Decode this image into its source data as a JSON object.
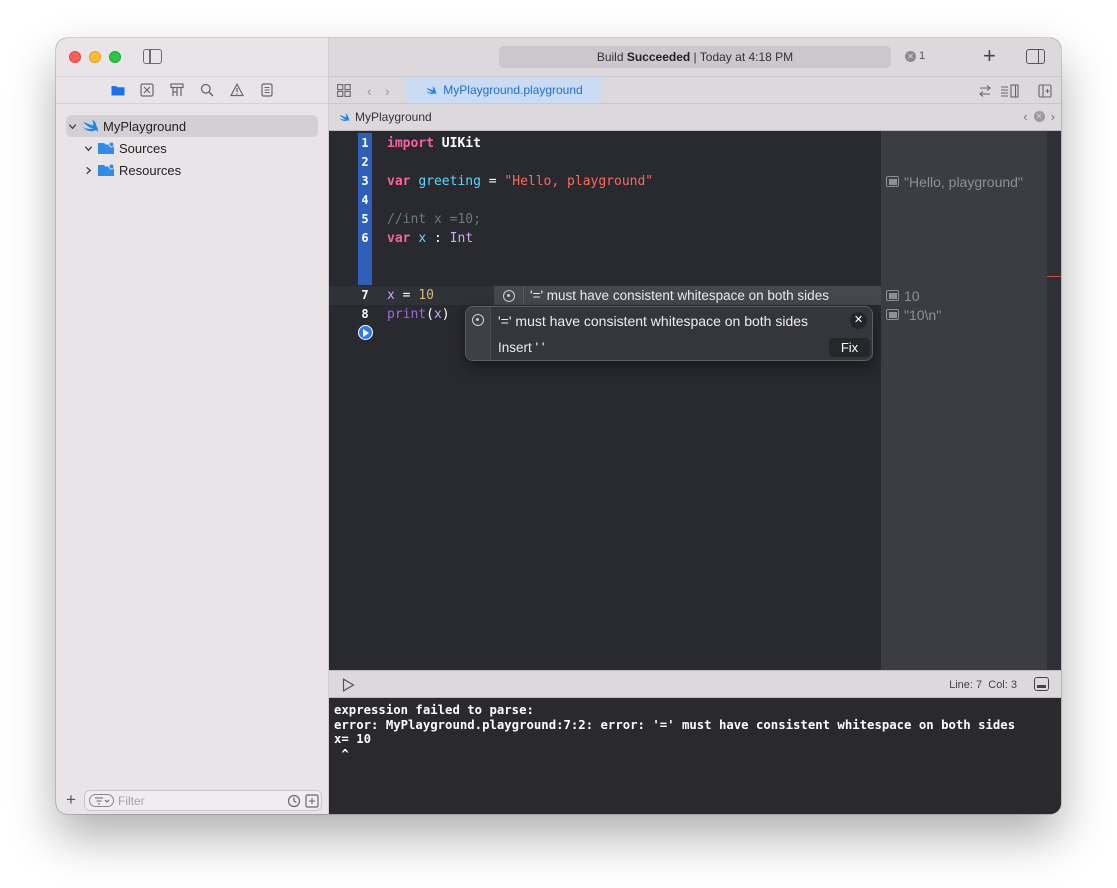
{
  "window": {
    "toolbar": {
      "activity_prefix": "Build ",
      "activity_status": "Succeeded",
      "activity_suffix": " | Today at 4:18 PM",
      "error_count": "1"
    },
    "tab": {
      "label": "MyPlayground.playground"
    },
    "jumpbar": {
      "item": "MyPlayground"
    }
  },
  "sidebar": {
    "nav_icons": [
      "folder-icon",
      "source-control-icon",
      "hierarchy-icon",
      "search-icon",
      "warning-icon",
      "report-icon"
    ],
    "tree": [
      {
        "label": "MyPlayground",
        "icon": "swift-icon",
        "expanded": true,
        "selected": true
      },
      {
        "label": "Sources",
        "icon": "folder-icon",
        "expanded": true
      },
      {
        "label": "Resources",
        "icon": "folder-icon",
        "expanded": false
      }
    ],
    "filter_placeholder": "Filter"
  },
  "editor": {
    "lines": [
      {
        "n": "1"
      },
      {
        "n": "2"
      },
      {
        "n": "3"
      },
      {
        "n": "4"
      },
      {
        "n": "5"
      },
      {
        "n": "6"
      },
      {
        "n": "7"
      },
      {
        "n": "8"
      }
    ],
    "code": {
      "l1_kw": "import",
      "l1_mod": "UIKit",
      "l3_kw": "var",
      "l3_name": "greeting",
      "l3_op": " = ",
      "l3_str": "\"Hello, playground\"",
      "l5_cmt": "//int x =10;",
      "l6_kw": "var",
      "l6_name": "x",
      "l6_op": " : ",
      "l6_type": "Int",
      "l7_name": "x",
      "l7_op": " = ",
      "l7_num": "10",
      "l8_fn": "print",
      "l8_open": "(",
      "l8_arg": "x",
      "l8_close": ")"
    },
    "inline_error": "'=' must have consistent whitespace on both sides",
    "popover": {
      "message": "'=' must have consistent whitespace on both sides",
      "fix_description": "Insert ' '",
      "fix_button": "Fix"
    },
    "results": [
      {
        "line": "3",
        "text": "\"Hello, playground\""
      },
      {
        "line": "7",
        "text": "10"
      },
      {
        "line": "8",
        "text": "\"10\\n\""
      }
    ]
  },
  "debug": {
    "line_label": "Line: 7",
    "col_label": "Col: 3"
  },
  "console": {
    "output": "expression failed to parse:\nerror: MyPlayground.playground:7:2: error: '=' must have consistent whitespace on both sides\nx= 10\n ^"
  },
  "colors": {
    "accent": "#2f7ae5",
    "editor_bg": "#292a30",
    "keyword": "#fc5fa3",
    "string": "#fc6a5d",
    "comment": "#6c7986",
    "number": "#d0bf69"
  }
}
